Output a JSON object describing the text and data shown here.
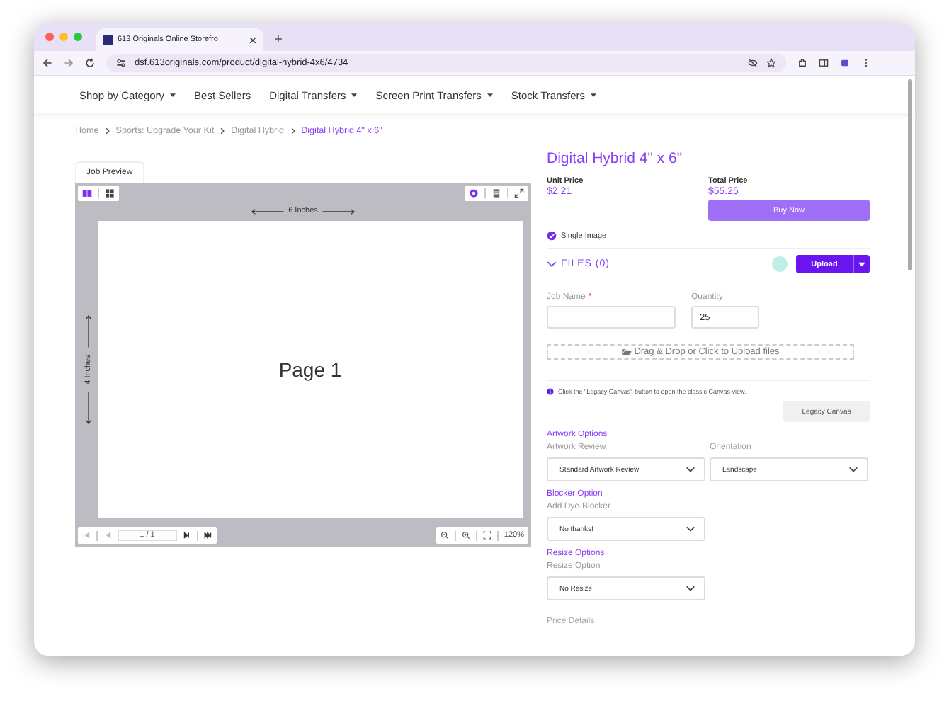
{
  "browser": {
    "tab_title": "613 Originals Online Storefro",
    "url": "dsf.613originals.com/product/digital-hybrid-4x6/4734"
  },
  "nav": [
    {
      "label": "Shop by Category",
      "dropdown": true
    },
    {
      "label": "Best Sellers",
      "dropdown": false
    },
    {
      "label": "Digital Transfers",
      "dropdown": true
    },
    {
      "label": "Screen Print Transfers",
      "dropdown": true
    },
    {
      "label": "Stock Transfers",
      "dropdown": true
    }
  ],
  "breadcrumb": [
    {
      "label": "Home",
      "current": false
    },
    {
      "label": "Sports: Upgrade Your Kit",
      "current": false
    },
    {
      "label": "Digital Hybrid",
      "current": false
    },
    {
      "label": "Digital Hybrid 4\" x 6\"",
      "current": true
    }
  ],
  "preview": {
    "tab_label": "Job Preview",
    "view_modes": [
      {
        "kind": "spread",
        "selected": true
      },
      {
        "kind": "grid",
        "selected": false
      }
    ],
    "width_label": "6 Inches",
    "height_label": "4 Inches",
    "page_label": "Page 1",
    "page_field": "1 / 1",
    "zoom": "120%"
  },
  "product": {
    "title": "Digital Hybrid 4\" x 6\"",
    "unit_price_label": "Unit Price",
    "unit_price": "$2.21",
    "total_price_label": "Total Price",
    "total_price": "$55.25",
    "buy_button": "Buy Now",
    "single_image": {
      "label": "Single Image",
      "checked": true
    },
    "files_label": "FILES (0)",
    "upload_button": "Upload",
    "job_name_label": "Job Name",
    "job_name_required_mark": "*",
    "quantity_label": "Quantity",
    "quantity": "25",
    "dropzone": "Drag & Drop or Click to Upload files",
    "info": "Click the \"Legacy Canvas\" button to open the classic Canvas view.",
    "legacy_button": "Legacy Canvas",
    "sections": [
      {
        "heading": "Artwork Options",
        "fields": [
          {
            "label": "Artwork Review",
            "value": "Standard Artwork Review"
          },
          {
            "label": "Orientation",
            "value": "Landscape"
          }
        ]
      },
      {
        "heading": "Blocker Option",
        "fields": [
          {
            "label": "Add Dye-Blocker",
            "value": "No thanks!"
          }
        ]
      },
      {
        "heading": "Resize Options",
        "fields": [
          {
            "label": "Resize Option",
            "value": "No Resize"
          }
        ]
      }
    ],
    "price_details": "Price Details"
  }
}
